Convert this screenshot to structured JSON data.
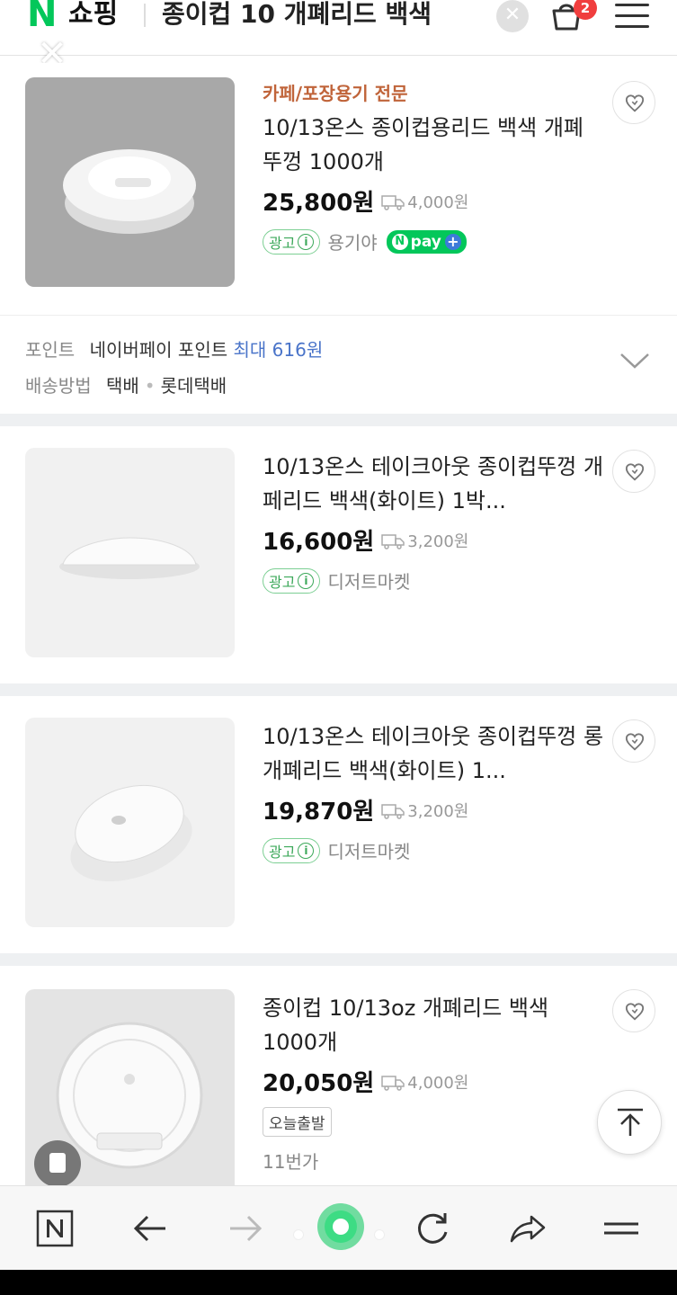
{
  "header": {
    "logo": "N",
    "section": "쇼핑",
    "query": "종이컵 10 개폐리드 백색",
    "cart_count": "2"
  },
  "products": [
    {
      "seller_tag": "카페/포장용기 전문",
      "title": "10/13온스 종이컵용리드 백색 개폐 뚜껑 1000개",
      "price": "25,800원",
      "shipping": "4,000원",
      "ad_label": "광고",
      "shop": "용기야",
      "npay": "pay"
    },
    {
      "title": "10/13온스 테이크아웃 종이컵뚜껑 개페리드 백색(화이트) 1박...",
      "price": "16,600원",
      "shipping": "3,200원",
      "ad_label": "광고",
      "shop": "디저트마켓"
    },
    {
      "title": "10/13온스 테이크아웃 종이컵뚜껑 롱개폐리드 백색(화이트) 1...",
      "price": "19,870원",
      "shipping": "3,200원",
      "ad_label": "광고",
      "shop": "디저트마켓"
    },
    {
      "title": "종이컵 10/13oz 개폐리드 백색 1000개",
      "price": "20,050원",
      "shipping": "4,000원",
      "badge": "오늘출발",
      "shop": "11번가"
    }
  ],
  "points": {
    "label": "포인트",
    "value": "네이버페이 포인트",
    "value_max": "최대 616원",
    "ship_label": "배송방법",
    "ship_value": "택배",
    "ship_carrier": "롯데택배"
  },
  "colors": {
    "brand": "#03c75a",
    "seller_tag": "#c0643a",
    "point_blue": "#4a74c9"
  }
}
